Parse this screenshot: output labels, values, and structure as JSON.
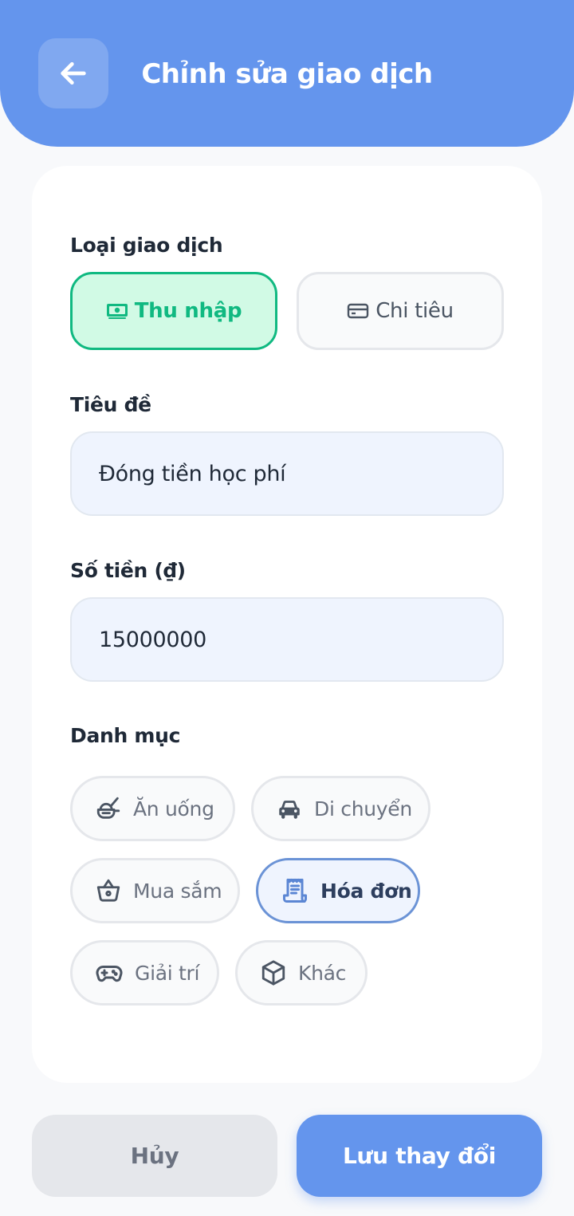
{
  "header": {
    "title": "Chỉnh sửa giao dịch"
  },
  "form": {
    "type_label": "Loại giao dịch",
    "types": [
      {
        "label": "Thu nhập",
        "icon": "money-icon",
        "selected": true
      },
      {
        "label": "Chi tiêu",
        "icon": "credit-card-icon",
        "selected": false
      }
    ],
    "title_label": "Tiêu đề",
    "title_value": "Đóng tiền học phí",
    "amount_label": "Số tiền (₫)",
    "amount_value": "15000000",
    "category_label": "Danh mục",
    "categories": [
      {
        "label": "Ăn uống",
        "icon": "food-icon",
        "selected": false
      },
      {
        "label": "Di chuyển",
        "icon": "car-icon",
        "selected": false
      },
      {
        "label": "Mua sắm",
        "icon": "shopping-basket-icon",
        "selected": false
      },
      {
        "label": "Hóa đơn",
        "icon": "receipt-icon",
        "selected": true
      },
      {
        "label": "Giải trí",
        "icon": "gamepad-icon",
        "selected": false
      },
      {
        "label": "Khác",
        "icon": "box-icon",
        "selected": false
      }
    ]
  },
  "actions": {
    "cancel_label": "Hủy",
    "save_label": "Lưu thay đổi"
  },
  "colors": {
    "primary": "#6495ED",
    "income": "#10B981",
    "income_bg": "#D1FAE5",
    "input_bg": "#EFF4FE",
    "active_chip_border": "#6B93D6"
  }
}
